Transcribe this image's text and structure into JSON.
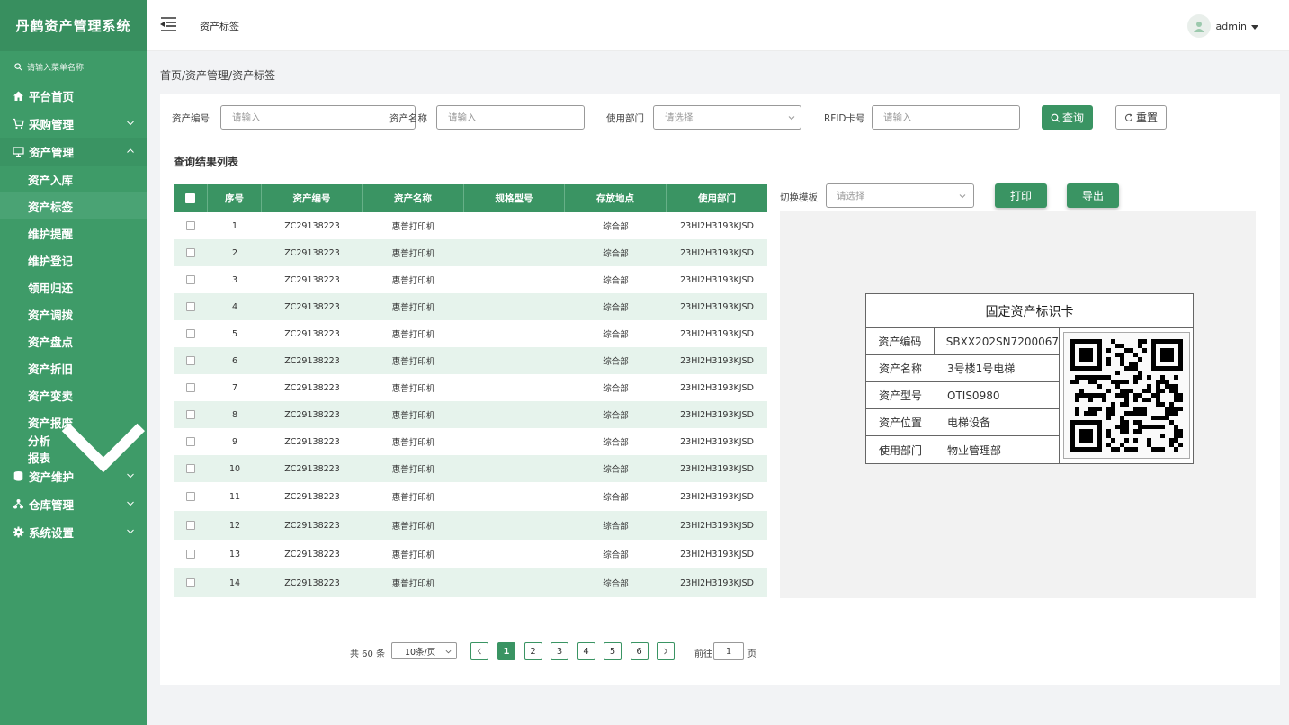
{
  "app": {
    "brand": "丹鹤资产管理系统"
  },
  "sidebar": {
    "search_placeholder": "请输入菜单名称",
    "menu": [
      {
        "label": "平台首页",
        "icon": "home-icon"
      },
      {
        "label": "采购管理",
        "icon": "cart-icon"
      },
      {
        "label": "资产管理",
        "icon": "monitor-icon"
      }
    ],
    "asset_sub": [
      "资产入库",
      "资产标签",
      "维护提醒",
      "维护登记",
      "领用归还",
      "资产调拨",
      "资产盘点",
      "资产折旧",
      "资产变卖",
      "资产报废",
      "分析报表"
    ],
    "menu_after": [
      {
        "label": "资产维护",
        "icon": "database-icon"
      },
      {
        "label": "仓库管理",
        "icon": "warehouse-icon"
      },
      {
        "label": "系统设置",
        "icon": "gear-icon"
      }
    ]
  },
  "header": {
    "title": "资产标签",
    "user": "admin"
  },
  "breadcrumb": "首页/资产管理/资产标签",
  "filters": {
    "asset_no_label": "资产编号",
    "asset_no_placeholder": "请输入",
    "asset_name_label": "资产名称",
    "asset_name_placeholder": "请输入",
    "dept_label": "使用部门",
    "dept_placeholder": "请选择",
    "rfid_label": "RFID卡号",
    "rfid_placeholder": "请输入",
    "query": "查询",
    "reset": "重置"
  },
  "result_title": "查询结果列表",
  "table": {
    "headers": [
      "序号",
      "资产编号",
      "资产名称",
      "规格型号",
      "存放地点",
      "使用部门"
    ],
    "rows": [
      [
        "1",
        "ZC29138223",
        "惠普打印机",
        "",
        "综合部",
        "23HI2H3193KJSD"
      ],
      [
        "2",
        "ZC29138223",
        "惠普打印机",
        "",
        "综合部",
        "23HI2H3193KJSD"
      ],
      [
        "3",
        "ZC29138223",
        "惠普打印机",
        "",
        "综合部",
        "23HI2H3193KJSD"
      ],
      [
        "4",
        "ZC29138223",
        "惠普打印机",
        "",
        "综合部",
        "23HI2H3193KJSD"
      ],
      [
        "5",
        "ZC29138223",
        "惠普打印机",
        "",
        "综合部",
        "23HI2H3193KJSD"
      ],
      [
        "6",
        "ZC29138223",
        "惠普打印机",
        "",
        "综合部",
        "23HI2H3193KJSD"
      ],
      [
        "7",
        "ZC29138223",
        "惠普打印机",
        "",
        "综合部",
        "23HI2H3193KJSD"
      ],
      [
        "8",
        "ZC29138223",
        "惠普打印机",
        "",
        "综合部",
        "23HI2H3193KJSD"
      ],
      [
        "9",
        "ZC29138223",
        "惠普打印机",
        "",
        "综合部",
        "23HI2H3193KJSD"
      ],
      [
        "10",
        "ZC29138223",
        "惠普打印机",
        "",
        "综合部",
        "23HI2H3193KJSD"
      ],
      [
        "11",
        "ZC29138223",
        "惠普打印机",
        "",
        "综合部",
        "23HI2H3193KJSD"
      ],
      [
        "12",
        "ZC29138223",
        "惠普打印机",
        "",
        "综合部",
        "23HI2H3193KJSD"
      ],
      [
        "13",
        "ZC29138223",
        "惠普打印机",
        "",
        "综合部",
        "23HI2H3193KJSD"
      ],
      [
        "14",
        "ZC29138223",
        "惠普打印机",
        "",
        "综合部",
        "23HI2H3193KJSD"
      ]
    ]
  },
  "template": {
    "label": "切换模板",
    "placeholder": "请选择",
    "print": "打印",
    "export": "导出"
  },
  "card": {
    "title": "固定资产标识卡",
    "rows": [
      {
        "key": "资产编码",
        "value": "SBXX202SN7200067"
      },
      {
        "key": "资产名称",
        "value": "3号楼1号电梯"
      },
      {
        "key": "资产型号",
        "value": "OTIS0980"
      },
      {
        "key": "资产位置",
        "value": "电梯设备"
      },
      {
        "key": "使用部门",
        "value": "物业管理部"
      }
    ]
  },
  "pagination": {
    "total": "共 60 条",
    "page_size": "10条/页",
    "pages": [
      "1",
      "2",
      "3",
      "4",
      "5",
      "6"
    ],
    "current": "1",
    "goto_label": "前往",
    "goto_value": "1",
    "page_suffix": "页"
  },
  "colors": {
    "primary": "#3a9463",
    "sidebar": "#3e9b68",
    "row_alt": "#e6f3ec"
  }
}
